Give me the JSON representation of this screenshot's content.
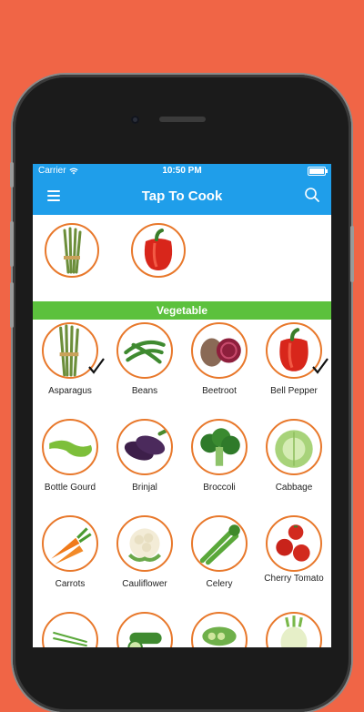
{
  "status_bar": {
    "carrier": "Carrier",
    "time": "10:50 PM"
  },
  "nav": {
    "title": "Tap To Cook"
  },
  "selected": [
    {
      "name": "Asparagus",
      "icon": "asparagus-icon"
    },
    {
      "name": "Bell Pepper",
      "icon": "bell-pepper-icon"
    }
  ],
  "section": {
    "title": "Vegetable"
  },
  "vegetables": [
    {
      "label": "Asparagus",
      "checked": true
    },
    {
      "label": "Beans",
      "checked": false
    },
    {
      "label": "Beetroot",
      "checked": false
    },
    {
      "label": "Bell Pepper",
      "checked": true
    },
    {
      "label": "Bottle Gourd",
      "checked": false
    },
    {
      "label": "Brinjal",
      "checked": false
    },
    {
      "label": "Broccoli",
      "checked": false
    },
    {
      "label": "Cabbage",
      "checked": false
    },
    {
      "label": "Carrots",
      "checked": false
    },
    {
      "label": "Cauliflower",
      "checked": false
    },
    {
      "label": "Celery",
      "checked": false
    },
    {
      "label": "Cherry Tomato",
      "checked": false
    }
  ],
  "colors": {
    "background": "#f06546",
    "header": "#1f9eea",
    "section_bar": "#5cc13d",
    "circle_border": "#e8782b"
  }
}
